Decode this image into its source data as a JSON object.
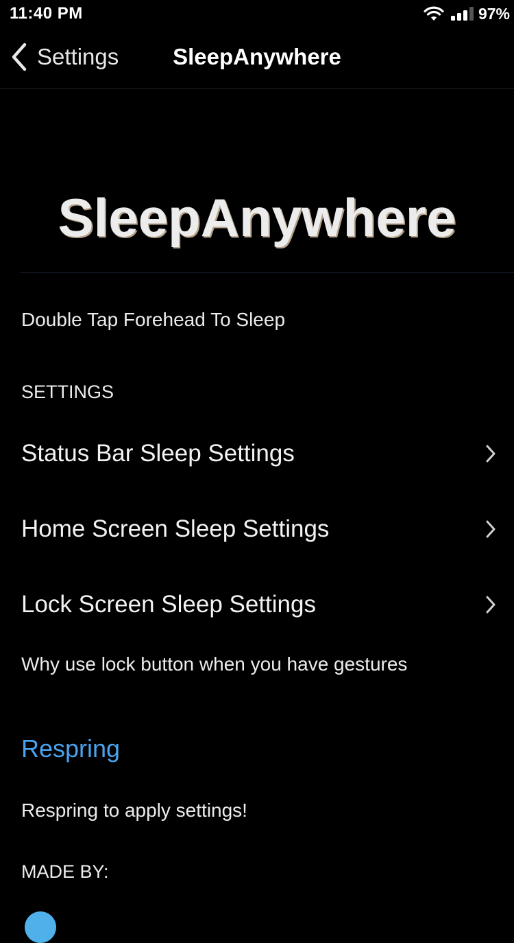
{
  "status_bar": {
    "time": "11:40 PM",
    "battery": "97%",
    "icons": [
      "wifi-icon",
      "signal-icon"
    ]
  },
  "nav": {
    "back_label": "Settings",
    "title": "SleepAnywhere",
    "icons": [
      "chevron-left-icon"
    ]
  },
  "header": {
    "title": "SleepAnywhere"
  },
  "description": "Double Tap Forehead To Sleep",
  "settings_section": {
    "header": "SETTINGS",
    "items": [
      {
        "label": "Status Bar Sleep Settings"
      },
      {
        "label": "Home Screen Sleep Settings"
      },
      {
        "label": "Lock Screen Sleep Settings"
      }
    ],
    "footer": "Why use lock button when you have gestures"
  },
  "respring": {
    "button_label": "Respring",
    "footer": "Respring to apply settings!"
  },
  "made_by": {
    "header": "MADE BY:"
  },
  "colors": {
    "background": "#000000",
    "accent": "#4aa3ef",
    "text": "#ececec"
  }
}
